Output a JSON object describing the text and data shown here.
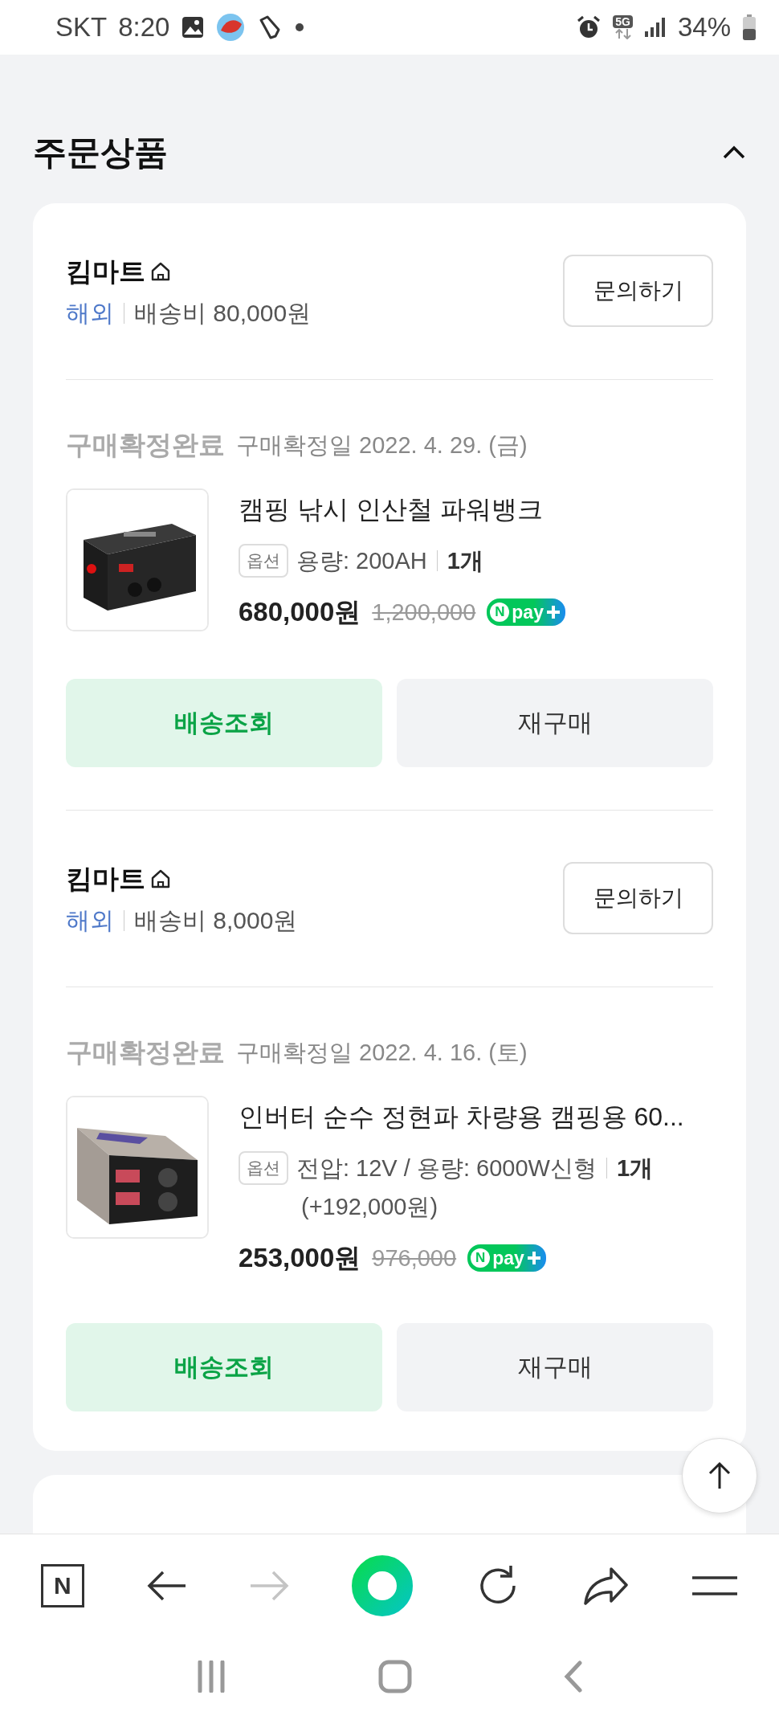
{
  "status_bar": {
    "carrier": "SKT",
    "time": "8:20",
    "network": "5G",
    "battery": "34%"
  },
  "section": {
    "title": "주문상품",
    "expanded": true
  },
  "orders": [
    {
      "store": "킴마트",
      "region": "해외",
      "shipping": "배송비 80,000원",
      "inquiry_button": "문의하기",
      "status": "구매확정완료",
      "confirm_date": "구매확정일 2022. 4. 29. (금)",
      "product": {
        "kind": "battery",
        "name": "캠핑 낚시 인산철 파워뱅크",
        "option_label": "옵션",
        "option": "용량: 200AH",
        "quantity": "1개",
        "price": "680,000원",
        "original_price": "1,200,000",
        "npay": {
          "mark": "N",
          "label": "pay"
        }
      },
      "buttons": [
        {
          "kind": "primary",
          "label": "배송조회"
        },
        {
          "kind": "secondary",
          "label": "재구매"
        }
      ]
    },
    {
      "store": "킴마트",
      "region": "해외",
      "shipping": "배송비 8,000원",
      "inquiry_button": "문의하기",
      "status": "구매확정완료",
      "confirm_date": "구매확정일 2022. 4. 16. (토)",
      "product": {
        "kind": "inverter",
        "name": "인버터 순수 정현파 차량용 캠핑용 60...",
        "option_label": "옵션",
        "option": "전압: 12V / 용량: 6000W신형",
        "quantity": "1개",
        "option_price": "(+192,000원)",
        "price": "253,000원",
        "original_price": "976,000",
        "npay": {
          "mark": "N",
          "label": "pay"
        }
      },
      "buttons": [
        {
          "kind": "primary",
          "label": "배송조회"
        },
        {
          "kind": "secondary",
          "label": "재구매"
        }
      ]
    }
  ],
  "browser_toolbar": [
    {
      "kind": "home",
      "label": "N",
      "disabled": false
    },
    {
      "kind": "back",
      "disabled": false
    },
    {
      "kind": "forward",
      "disabled": true
    },
    {
      "kind": "green",
      "disabled": false
    },
    {
      "kind": "reload",
      "disabled": false
    },
    {
      "kind": "share",
      "disabled": false
    },
    {
      "kind": "menu",
      "disabled": false
    }
  ]
}
